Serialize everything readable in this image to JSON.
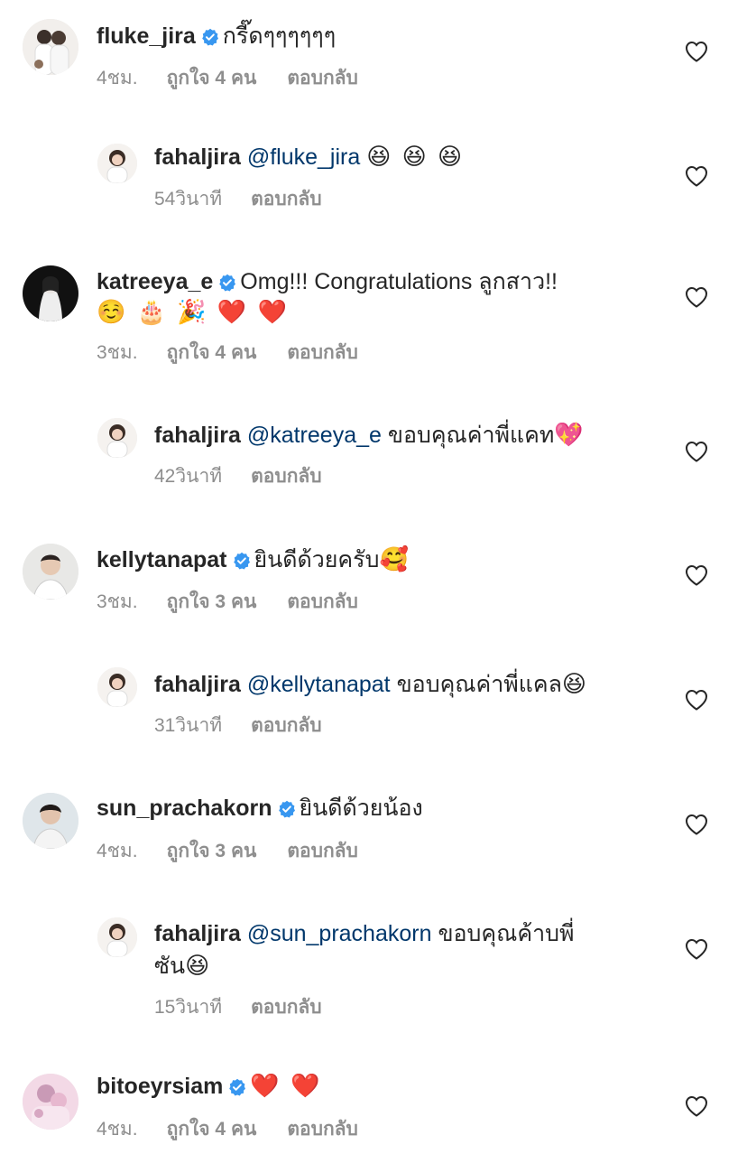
{
  "comments": [
    {
      "username": "fluke_jira",
      "verified": true,
      "text": "กรี๊ดๆๆๆๆๆๆ",
      "time": "4ชม.",
      "likes": "ถูกใจ 4 คน",
      "reply_label": "ตอบกลับ",
      "avatar_desc": "couple-photo"
    },
    {
      "username": "fahaljira",
      "mention": "@fluke_jira",
      "emoji": "😆 😆 😆",
      "time": "54วินาที",
      "reply_label": "ตอบกลับ"
    },
    {
      "username": "katreeya_e",
      "verified": true,
      "text": "Omg!!! Congratulations ลูกสาว!!",
      "emoji": "☺️ 🎂 🎉 ❤️ ❤️",
      "time": "3ชม.",
      "likes": "ถูกใจ 4 คน",
      "reply_label": "ตอบกลับ"
    },
    {
      "username": "fahaljira",
      "mention": "@katreeya_e",
      "text": "ขอบคุณค่าพี่แคท",
      "emoji": "💖",
      "time": "42วินาที",
      "reply_label": "ตอบกลับ"
    },
    {
      "username": "kellytanapat",
      "verified": true,
      "text": "ยินดีด้วยครับ",
      "emoji": "🥰",
      "time": "3ชม.",
      "likes": "ถูกใจ 3 คน",
      "reply_label": "ตอบกลับ"
    },
    {
      "username": "fahaljira",
      "mention": "@kellytanapat",
      "text": "ขอบคุณค่าพี่แคล",
      "emoji": "😆",
      "time": "31วินาที",
      "reply_label": "ตอบกลับ"
    },
    {
      "username": "sun_prachakorn",
      "verified": true,
      "text": "ยินดีด้วยน้อง",
      "time": "4ชม.",
      "likes": "ถูกใจ 3 คน",
      "reply_label": "ตอบกลับ"
    },
    {
      "username": "fahaljira",
      "mention": "@sun_prachakorn",
      "text": "ขอบคุณค้าบพี่",
      "text_line2": "ซัน",
      "emoji": "😆",
      "time": "15วินาที",
      "reply_label": "ตอบกลับ"
    },
    {
      "username": "bitoeyrsiam",
      "verified": true,
      "emoji": "❤️ ❤️",
      "time": "4ชม.",
      "likes": "ถูกใจ 4 คน",
      "reply_label": "ตอบกลับ"
    }
  ],
  "icons": {
    "verified": "verified-badge-icon",
    "like": "heart-outline-icon"
  },
  "colors": {
    "verified": "#3897f0",
    "mention": "#00376b",
    "meta": "#8e8e8e",
    "text": "#262626"
  }
}
